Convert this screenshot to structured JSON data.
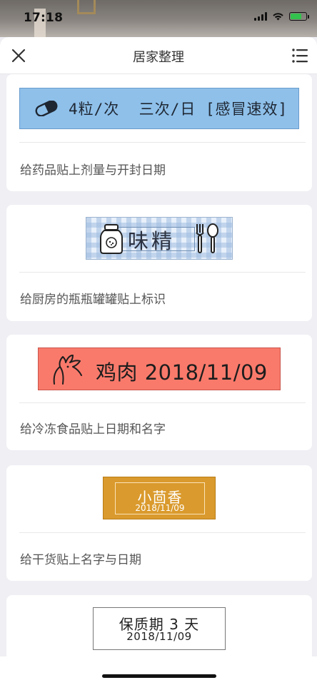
{
  "status_bar": {
    "time": "17:18"
  },
  "nav": {
    "title": "居家整理"
  },
  "cards": [
    {
      "label_text": "4粒/次  三次/日 [感冒速效]",
      "caption": "给药品贴上剂量与开封日期",
      "icon": "pill-icon"
    },
    {
      "label_text": "味精",
      "caption": "给厨房的瓶瓶罐罐贴上标识",
      "icon": "jar-icon"
    },
    {
      "label_text": "鸡肉 2018/11/09",
      "caption": "给冷冻食品贴上日期和名字",
      "icon": "chicken-icon"
    },
    {
      "label_text": "小茴香",
      "label_date": "2018/11/09",
      "caption": "给干货贴上名字与日期"
    },
    {
      "label_text": "保质期 3 天",
      "label_date": "2018/11/09"
    }
  ],
  "colors": {
    "medicine_label": "#8ec0ea",
    "chicken_label": "#f97a6b",
    "fennel_label": "#da9a2d",
    "gingham": "#a0bee1"
  }
}
